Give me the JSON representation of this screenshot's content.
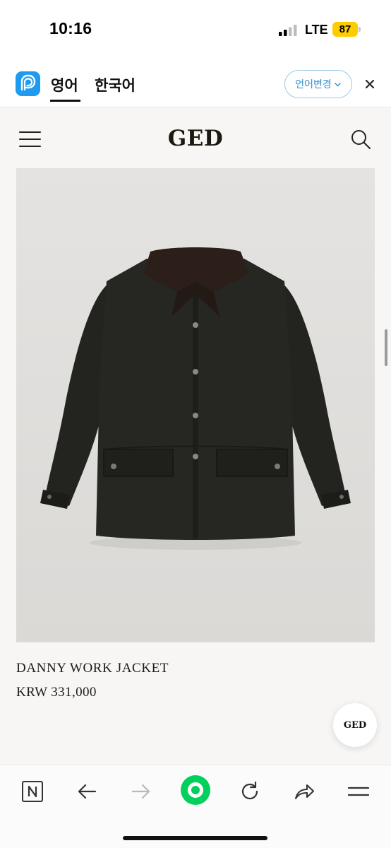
{
  "status_bar": {
    "time": "10:16",
    "network": "LTE",
    "battery": "87"
  },
  "translate_bar": {
    "tabs": [
      {
        "label": "영어",
        "active": true
      },
      {
        "label": "한국어",
        "active": false
      }
    ],
    "change_button": "언어변경",
    "icons": [
      "papago-icon",
      "chevron-down-icon",
      "close-icon"
    ]
  },
  "site": {
    "logo": "GED",
    "icons": [
      "hamburger-menu-icon",
      "search-icon"
    ]
  },
  "product": {
    "name": "DANNY WORK JACKET",
    "price": "KRW 331,000"
  },
  "floating_button": {
    "label": "GED"
  },
  "toolbar": {
    "icons": [
      "naver-n-icon",
      "back-arrow-icon",
      "forward-arrow-icon",
      "green-dot-icon",
      "reload-icon",
      "share-icon",
      "menu-icon"
    ]
  },
  "colors": {
    "accent_blue": "#1e9af0",
    "battery_yellow": "#ffcc00",
    "naver_green": "#03cf5d",
    "page_bg": "#f7f6f4"
  }
}
